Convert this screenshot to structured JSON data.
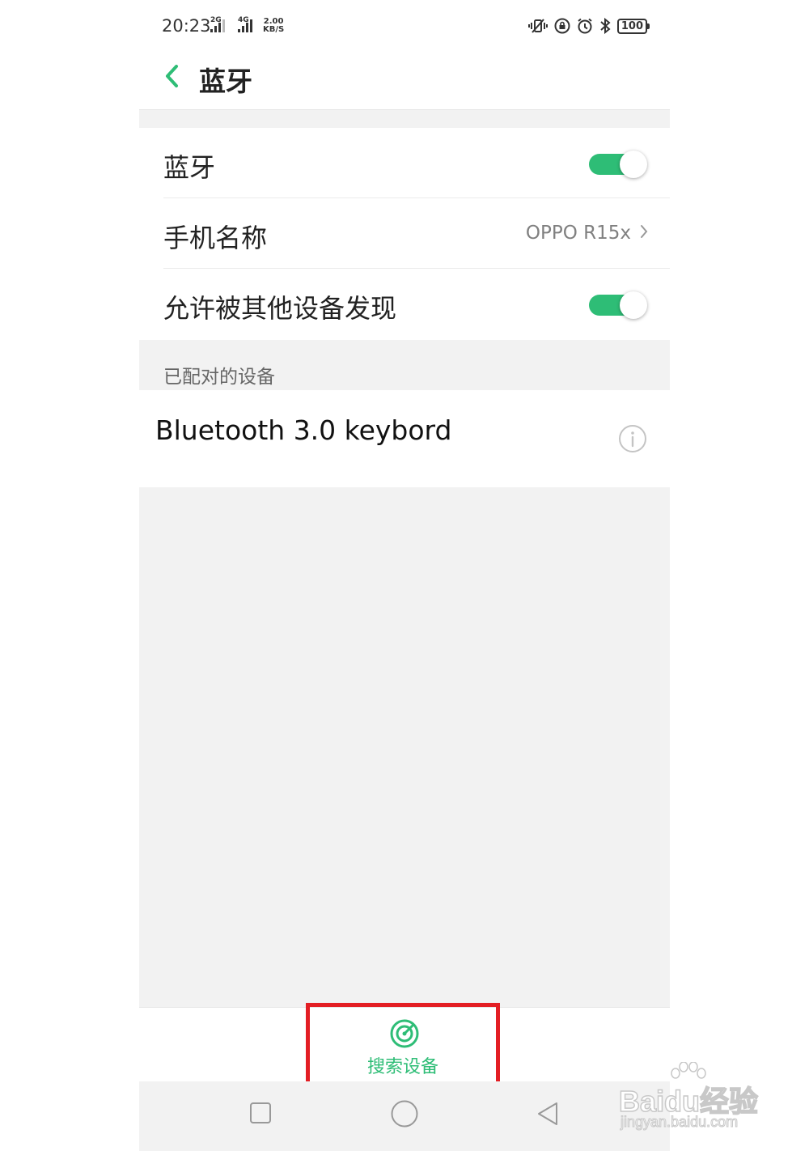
{
  "status_bar": {
    "time": "20:23",
    "sim1_network": "2G",
    "sim2_network": "4G",
    "speed_value": "2.00",
    "speed_unit": "KB/S",
    "battery": "100",
    "icons": [
      "vibrate-icon",
      "rotation-lock-icon",
      "alarm-icon",
      "bluetooth-icon"
    ]
  },
  "header": {
    "title": "蓝牙",
    "back_icon": "chevron-left-icon"
  },
  "settings": {
    "bluetooth": {
      "label": "蓝牙",
      "enabled": true
    },
    "phone_name": {
      "label": "手机名称",
      "value": "OPPO R15x"
    },
    "discoverable": {
      "label": "允许被其他设备发现",
      "enabled": true
    }
  },
  "paired": {
    "section_label": "已配对的设备",
    "devices": [
      {
        "name": "Bluetooth 3.0 keybord",
        "icon": "info-icon"
      }
    ]
  },
  "bottom_action": {
    "label": "搜索设备",
    "icon": "radar-search-icon"
  },
  "nav_bar": {
    "buttons": [
      "recent-apps-icon",
      "home-icon",
      "back-triangle-icon"
    ]
  },
  "watermark": {
    "brand": "Baidu经验",
    "url": "jingyan.baidu.com"
  },
  "colors": {
    "accent": "#2ebd76",
    "highlight_box": "#e31e24",
    "section_bg": "#f2f2f2"
  }
}
